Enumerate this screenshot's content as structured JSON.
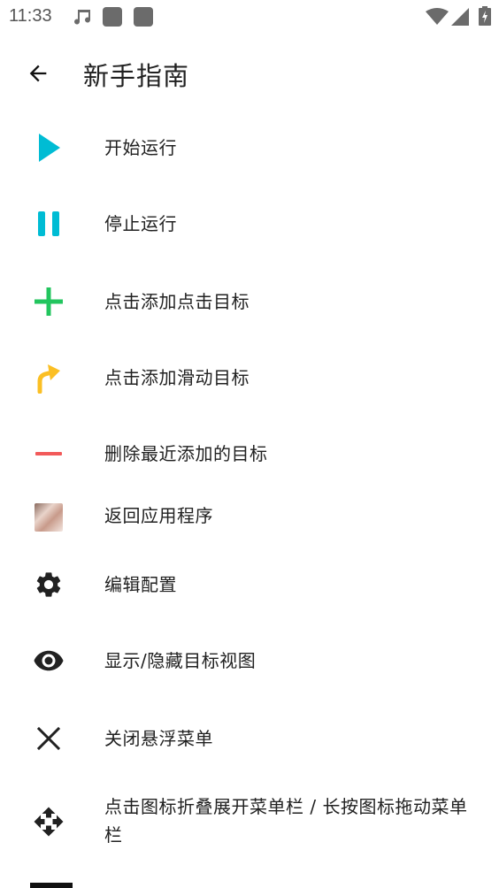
{
  "status_bar": {
    "time": "11:33"
  },
  "app_bar": {
    "title": "新手指南"
  },
  "items": [
    {
      "label": "开始运行",
      "icon": "play-icon",
      "color": "#00bcd4"
    },
    {
      "label": "停止运行",
      "icon": "pause-icon",
      "color": "#00bcd4"
    },
    {
      "label": "点击添加点击目标",
      "icon": "plus-icon",
      "color": "#22c55e"
    },
    {
      "label": "点击添加滑动目标",
      "icon": "swipe-arrow-icon",
      "color": "#fbbf24"
    },
    {
      "label": "删除最近添加的目标",
      "icon": "minus-icon",
      "color": "#f25a5a"
    },
    {
      "label": "返回应用程序",
      "icon": "app-thumbnail-icon"
    },
    {
      "label": "编辑配置",
      "icon": "gear-icon",
      "color": "#212121"
    },
    {
      "label": "显示/隐藏目标视图",
      "icon": "eye-icon",
      "color": "#212121"
    },
    {
      "label": "关闭悬浮菜单",
      "icon": "close-icon",
      "color": "#212121"
    },
    {
      "label": "点击图标折叠展开菜单栏 / 长按图标拖动菜单栏",
      "icon": "move-icon",
      "color": "#212121"
    }
  ]
}
